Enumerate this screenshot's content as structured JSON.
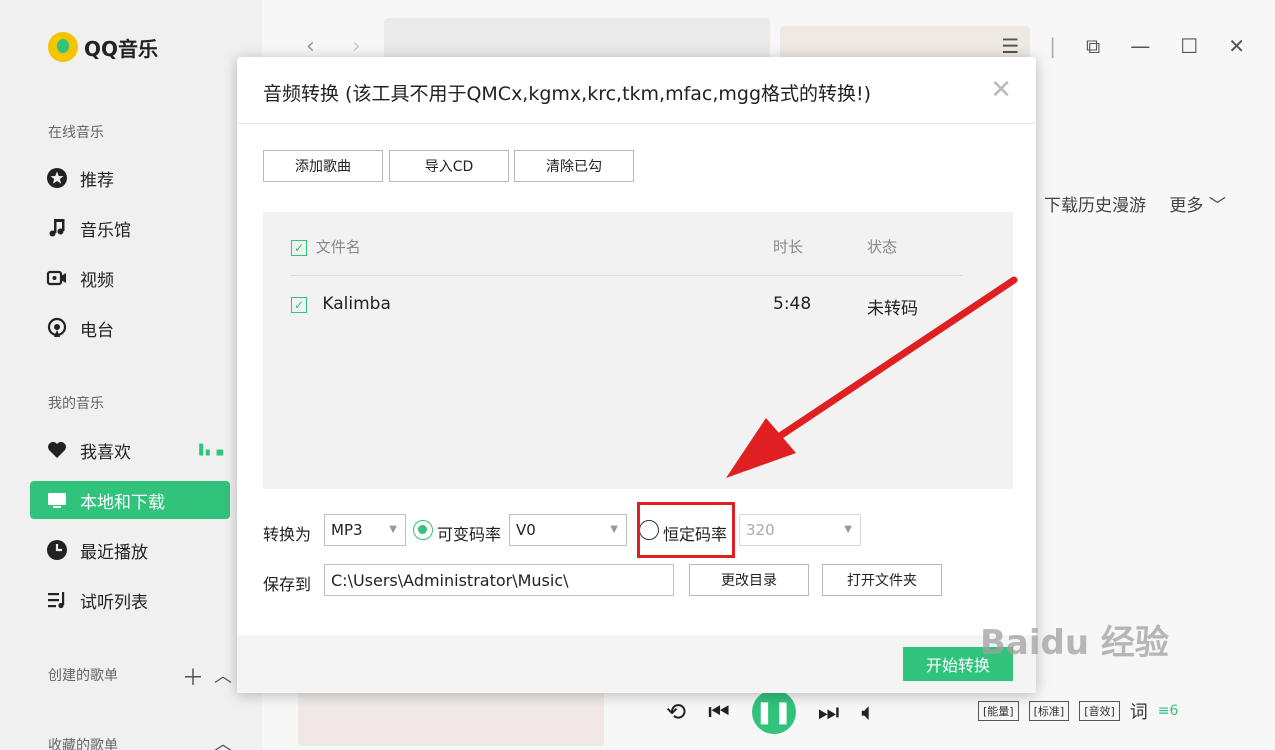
{
  "app": {
    "name": "QQ音乐"
  },
  "sidebar": {
    "online_section": "在线音乐",
    "online_items": [
      {
        "label": "推荐",
        "icon": "star-icon"
      },
      {
        "label": "音乐馆",
        "icon": "music-note-icon"
      },
      {
        "label": "视频",
        "icon": "video-icon"
      },
      {
        "label": "电台",
        "icon": "radio-icon"
      }
    ],
    "my_section": "我的音乐",
    "my_items": [
      {
        "label": "我喜欢",
        "icon": "heart-icon"
      },
      {
        "label": "本地和下载",
        "icon": "monitor-icon",
        "active": true
      },
      {
        "label": "最近播放",
        "icon": "clock-icon"
      },
      {
        "label": "试听列表",
        "icon": "playlist-icon"
      }
    ],
    "created_section": "创建的歌单",
    "collected_section": "收藏的歌单"
  },
  "header": {
    "tabs_right": [
      "下载历史漫游",
      "更多"
    ]
  },
  "dialog": {
    "title": "音频转换 (该工具不用于QMCx,kgmx,krc,tkm,mfac,mgg格式的转换!)",
    "buttons": {
      "add": "添加歌曲",
      "import_cd": "导入CD",
      "clear_checked": "清除已勾"
    },
    "columns": {
      "filename": "文件名",
      "duration": "时长",
      "status": "状态"
    },
    "rows": [
      {
        "checked": true,
        "filename": "Kalimba",
        "duration": "5:48",
        "status": "未转码"
      }
    ],
    "convert_label": "转换为",
    "format": "MP3",
    "vbr_label": "可变码率",
    "vbr_value": "V0",
    "cbr_label": "恒定码率",
    "cbr_value": "320",
    "selected_mode": "vbr",
    "save_label": "保存到",
    "save_path": "C:\\Users\\Administrator\\Music\\",
    "change_dir": "更改目录",
    "open_folder": "打开文件夹",
    "start": "开始转换"
  },
  "player": {
    "tags": [
      "[能量]",
      "[标准]",
      "[音效]"
    ],
    "lyric_button": "词",
    "count": "6"
  },
  "watermark": "Baidu 经验",
  "colors": {
    "accent": "#31c27c",
    "annotation": "#e02020"
  }
}
